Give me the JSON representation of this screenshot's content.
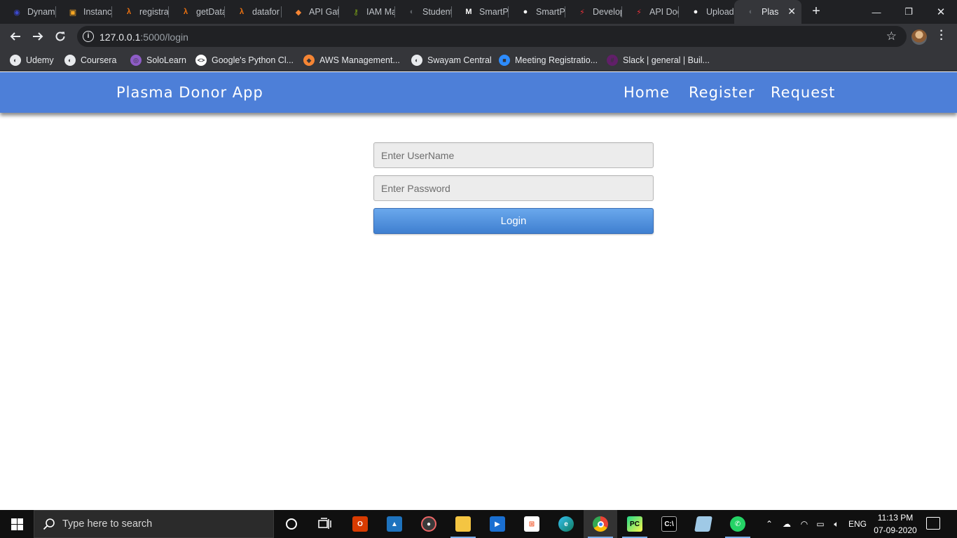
{
  "browser": {
    "tabs": [
      {
        "title": "Dynamo",
        "icon": "dynamodb-icon",
        "color": "#3b48cc",
        "glyph": "◉"
      },
      {
        "title": "Instance",
        "icon": "aws-box-icon",
        "color": "#f5a623",
        "glyph": "▣"
      },
      {
        "title": "registra",
        "icon": "lambda-icon",
        "color": "#ec7211",
        "glyph": "λ"
      },
      {
        "title": "getData",
        "icon": "lambda-icon",
        "color": "#ec7211",
        "glyph": "λ"
      },
      {
        "title": "datafor",
        "icon": "lambda-icon",
        "color": "#ec7211",
        "glyph": "λ"
      },
      {
        "title": "API Gat",
        "icon": "aws-cube-icon",
        "color": "#f58534",
        "glyph": "◆"
      },
      {
        "title": "IAM Ma",
        "icon": "iam-key-icon",
        "color": "#7aa116",
        "glyph": "⚷"
      },
      {
        "title": "Student",
        "icon": "globe-icon",
        "color": "#5f6368",
        "glyph": "◐"
      },
      {
        "title": "SmartP",
        "icon": "gmail-icon",
        "color": "#ffffff",
        "glyph": "M"
      },
      {
        "title": "SmartP",
        "icon": "github-icon",
        "color": "#ffffff",
        "glyph": "●"
      },
      {
        "title": "Develop",
        "icon": "postman-bolt-icon",
        "color": "#e8313a",
        "glyph": "⚡"
      },
      {
        "title": "API Doc",
        "icon": "postman-bolt-icon",
        "color": "#e8313a",
        "glyph": "⚡"
      },
      {
        "title": "Upload",
        "icon": "github-icon",
        "color": "#ffffff",
        "glyph": "●"
      },
      {
        "title": "Plas",
        "icon": "globe-icon",
        "color": "#5f6368",
        "glyph": "◐"
      }
    ],
    "url_host": "127.0.0.1",
    "url_path": ":5000/login",
    "bookmarks": [
      {
        "label": "Udemy",
        "icon": "globe-icon",
        "color": "#e8eaed",
        "glyph": "◐"
      },
      {
        "label": "Coursera",
        "icon": "globe-icon",
        "color": "#e8eaed",
        "glyph": "◐"
      },
      {
        "label": "SoloLearn",
        "icon": "sololearn-icon",
        "color": "#8e5cc7",
        "glyph": "◎"
      },
      {
        "label": "Google's Python Cl...",
        "icon": "google-dev-icon",
        "color": "#ffffff",
        "glyph": "<>"
      },
      {
        "label": "AWS Management...",
        "icon": "aws-cube-icon",
        "color": "#f58534",
        "glyph": "◆"
      },
      {
        "label": "Swayam Central",
        "icon": "globe-icon",
        "color": "#e8eaed",
        "glyph": "◐"
      },
      {
        "label": "Meeting Registratio...",
        "icon": "zoom-icon",
        "color": "#2d8cff",
        "glyph": "■"
      },
      {
        "label": "Slack | general | Buil...",
        "icon": "slack-icon",
        "color": "#611f69",
        "glyph": "#"
      }
    ]
  },
  "app": {
    "brand": "Plasma Donor App",
    "nav": [
      "Home",
      "Register",
      "Request"
    ],
    "colors": {
      "navbar": "#4d7fd8",
      "button": "#3f7fd0"
    }
  },
  "login": {
    "username_placeholder": "Enter UserName",
    "password_placeholder": "Enter Password",
    "button_label": "Login"
  },
  "taskbar": {
    "search_placeholder": "Type here to search",
    "language": "ENG",
    "time": "11:13 PM",
    "date": "07-09-2020"
  }
}
